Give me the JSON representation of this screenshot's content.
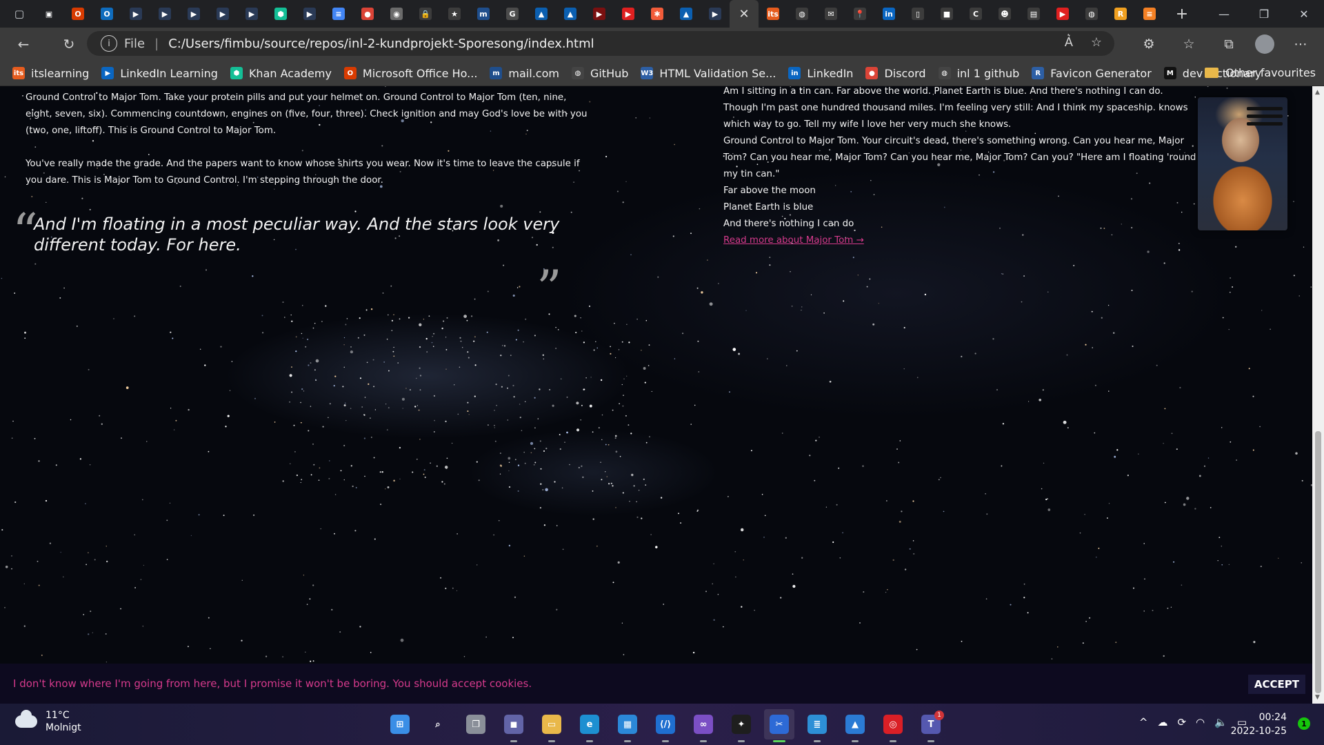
{
  "browser": {
    "tabs": [
      {
        "icon": "sidebar-icon",
        "glyph": "▣",
        "color": "#202124"
      },
      {
        "icon": "office-icon",
        "glyph": "O",
        "color": "#d83b01"
      },
      {
        "icon": "outlook-icon",
        "glyph": "O",
        "color": "#0f6cbd"
      },
      {
        "icon": "video-icon",
        "glyph": "▶",
        "color": "#2a3a56"
      },
      {
        "icon": "video-icon",
        "glyph": "▶",
        "color": "#2a3a56"
      },
      {
        "icon": "video-icon",
        "glyph": "▶",
        "color": "#2a3a56"
      },
      {
        "icon": "video-icon",
        "glyph": "▶",
        "color": "#2a3a56"
      },
      {
        "icon": "video-icon",
        "glyph": "▶",
        "color": "#2a3a56"
      },
      {
        "icon": "khan-icon",
        "glyph": "⬢",
        "color": "#14bf96"
      },
      {
        "icon": "video-icon",
        "glyph": "▶",
        "color": "#2a3a56"
      },
      {
        "icon": "docs-icon",
        "glyph": "≡",
        "color": "#4285f4"
      },
      {
        "icon": "chrome-icon",
        "glyph": "●",
        "color": "#db4437"
      },
      {
        "icon": "photo-icon",
        "glyph": "◉",
        "color": "#6b6b6b"
      },
      {
        "icon": "lock-icon",
        "glyph": "🔒",
        "color": "#3c3c3c"
      },
      {
        "icon": "star-icon",
        "glyph": "★",
        "color": "#3c3c3c"
      },
      {
        "icon": "mailcom-icon",
        "glyph": "m",
        "color": "#1f4e8c"
      },
      {
        "icon": "grammarly-icon",
        "glyph": "G",
        "color": "#4b4b4b"
      },
      {
        "icon": "azure-icon",
        "glyph": "▲",
        "color": "#0b5fb0"
      },
      {
        "icon": "azure-icon",
        "glyph": "▲",
        "color": "#0b5fb0"
      },
      {
        "icon": "youtube-icon",
        "glyph": "▶",
        "color": "#7a1010"
      },
      {
        "icon": "youtube-icon",
        "glyph": "▶",
        "color": "#e02020"
      },
      {
        "icon": "asterisk-icon",
        "glyph": "✱",
        "color": "#f25c3a"
      },
      {
        "icon": "azure-icon",
        "glyph": "▲",
        "color": "#0b5fb0"
      },
      {
        "icon": "video-icon",
        "glyph": "▶",
        "color": "#2a3a56"
      },
      {
        "icon": "close-icon",
        "glyph": "✕",
        "color": "#3b3b3b",
        "active": true
      },
      {
        "icon": "its-icon",
        "glyph": "its",
        "color": "#e65c1e"
      },
      {
        "icon": "github-icon",
        "glyph": "◍",
        "color": "#3c3c3c"
      },
      {
        "icon": "mail-icon",
        "glyph": "✉",
        "color": "#3c3c3c"
      },
      {
        "icon": "pin-icon",
        "glyph": "📍",
        "color": "#3c3c3c"
      },
      {
        "icon": "linkedin-icon",
        "glyph": "in",
        "color": "#0a66c2"
      },
      {
        "icon": "page-icon",
        "glyph": "▯",
        "color": "#3c3c3c"
      },
      {
        "icon": "camera-icon",
        "glyph": "■",
        "color": "#3c3c3c"
      },
      {
        "icon": "codepen-icon",
        "glyph": "C",
        "color": "#3c3c3c"
      },
      {
        "icon": "people-icon",
        "glyph": "☻",
        "color": "#3c3c3c"
      },
      {
        "icon": "pages-icon",
        "glyph": "▤",
        "color": "#3c3c3c"
      },
      {
        "icon": "youtube-icon",
        "glyph": "▶",
        "color": "#e02020"
      },
      {
        "icon": "github-icon",
        "glyph": "◍",
        "color": "#3c3c3c"
      },
      {
        "icon": "r-icon",
        "glyph": "R",
        "color": "#f0a020"
      },
      {
        "icon": "stackoverflow-icon",
        "glyph": "≡",
        "color": "#f48024"
      }
    ],
    "address": {
      "scheme": "File",
      "url": "C:/Users/fimbu/source/repos/inl-2-kundprojekt-Sporesong/index.html"
    },
    "favourites": [
      {
        "label": "itslearning",
        "icon": "its-icon",
        "glyph": "its",
        "color": "#e65c1e"
      },
      {
        "label": "LinkedIn Learning",
        "icon": "linkedin-learning-icon",
        "glyph": "▶",
        "color": "#0a66c2"
      },
      {
        "label": "Khan Academy",
        "icon": "khan-icon",
        "glyph": "⬢",
        "color": "#14bf96"
      },
      {
        "label": "Microsoft Office Ho...",
        "icon": "office-icon",
        "glyph": "O",
        "color": "#d83b01"
      },
      {
        "label": "mail.com",
        "icon": "mailcom-icon",
        "glyph": "m",
        "color": "#1f4e8c"
      },
      {
        "label": "GitHub",
        "icon": "github-icon",
        "glyph": "◍",
        "color": "#444"
      },
      {
        "label": "HTML Validation Se...",
        "icon": "w3c-icon",
        "glyph": "W3",
        "color": "#2d5fa5"
      },
      {
        "label": "LinkedIn",
        "icon": "linkedin-icon",
        "glyph": "in",
        "color": "#0a66c2"
      },
      {
        "label": "Discord",
        "icon": "discord-icon",
        "glyph": "●",
        "color": "#db4437"
      },
      {
        "label": "inl 1 github",
        "icon": "github-icon",
        "glyph": "◍",
        "color": "#444"
      },
      {
        "label": "Favicon Generator",
        "icon": "favicon-icon",
        "glyph": "R",
        "color": "#2d5fa5"
      },
      {
        "label": "dev dictionary",
        "icon": "devdict-icon",
        "glyph": "M",
        "color": "#111"
      }
    ],
    "other_favourites": "Other favourites"
  },
  "page": {
    "left_paragraphs": [
      "Ground Control to Major Tom. Take your protein pills and put your helmet on. Ground Control to Major Tom (ten, nine, eight, seven, six). Commencing countdown, engines on (five, four, three). Check ignition and may God's love be with you (two, one, liftoff). This is Ground Control to Major Tom.",
      "You've really made the grade. And the papers want to know whose shirts you wear. Now it's time to leave the capsule if you dare. This is Major Tom to Ground Control. I'm stepping through the door."
    ],
    "quote": "And I'm floating in a most peculiar way. And the stars look very different today. For here.",
    "quote_open": "“",
    "quote_close": "”",
    "right_lines": [
      "Am I sitting in a tin can. Far above the world. Planet Earth is blue. And there's nothing I can do. Though I'm past one hundred thousand miles. I'm feeling very still: And I think my spaceship. knows which way to go. Tell my wife I love her very much she knows.",
      "Ground Control to Major Tom. Your circuit's dead, there's something wrong. Can you hear me, Major Tom? Can you hear me, Major Tom? Can you hear me, Major Tom? Can you? \"Here am I floating 'round my tin can.\"",
      "Far above the moon",
      "Planet Earth is blue",
      "And there's nothing I can do"
    ],
    "read_more": "Read more about Major Tom →",
    "cookie_message": "I don't know where I'm going from here, but I promise it won't be boring. You should accept cookies.",
    "accept_label": "ACCEPT",
    "accent_color": "#d63a8c"
  },
  "taskbar": {
    "weather_temp": "11°C",
    "weather_desc": "Molnigt",
    "apps": [
      {
        "name": "start-button",
        "glyph": "⊞",
        "color": "#3a8ee6"
      },
      {
        "name": "search-button",
        "glyph": "⌕",
        "color": "transparent"
      },
      {
        "name": "task-view-button",
        "glyph": "❐",
        "color": "#8a8f99"
      },
      {
        "name": "teams-chat-app",
        "glyph": "◼",
        "color": "#6264a7"
      },
      {
        "name": "file-explorer-app",
        "glyph": "▭",
        "color": "#e9b84a"
      },
      {
        "name": "edge-app",
        "glyph": "e",
        "color": "#1d8fd1"
      },
      {
        "name": "store-app",
        "glyph": "▦",
        "color": "#2b88d8"
      },
      {
        "name": "vscode-insiders-app",
        "glyph": "⟨/⟩",
        "color": "#1f6fd0"
      },
      {
        "name": "visual-studio-app",
        "glyph": "∞",
        "color": "#7b4fc4"
      },
      {
        "name": "figma-app",
        "glyph": "✦",
        "color": "#1e1e1e"
      },
      {
        "name": "snipping-tool-app",
        "glyph": "✂",
        "color": "#2d6ad6",
        "active": true
      },
      {
        "name": "notepad-app",
        "glyph": "≣",
        "color": "#2d8fd6"
      },
      {
        "name": "photos-app",
        "glyph": "▲",
        "color": "#2b7bd4"
      },
      {
        "name": "creative-cloud-app",
        "glyph": "◎",
        "color": "#da1f26"
      },
      {
        "name": "teams-app",
        "glyph": "T",
        "color": "#5558af",
        "badge": "1"
      }
    ],
    "time": "00:24",
    "date": "2022-10-25",
    "notification_count": "1"
  }
}
